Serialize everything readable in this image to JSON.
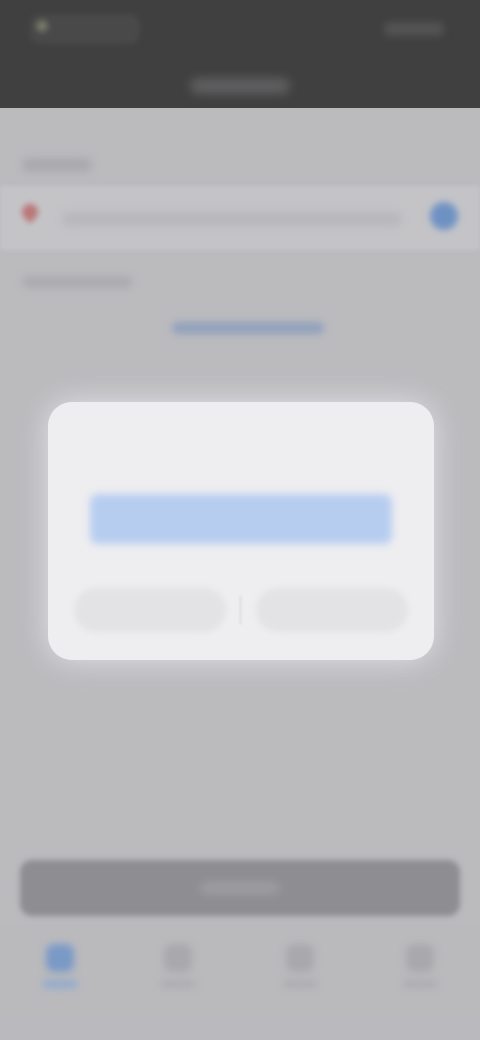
{
  "status_bar": {
    "left_text": "",
    "right_text": ""
  },
  "header": {
    "title": ""
  },
  "location": {
    "section_label": "",
    "address": "",
    "sub_label": "",
    "link": ""
  },
  "dialog": {
    "message": "",
    "link": "",
    "cancel_label": "",
    "confirm_label": ""
  },
  "footer": {
    "primary_button_label": ""
  },
  "tab_bar": {
    "tabs": [
      {
        "label": "",
        "icon": "home-icon",
        "active": true
      },
      {
        "label": "",
        "icon": "tab-icon",
        "active": false
      },
      {
        "label": "",
        "icon": "tab-icon",
        "active": false
      },
      {
        "label": "",
        "icon": "profile-icon",
        "active": false
      }
    ]
  },
  "colors": {
    "accent": "#5f8fd3",
    "dialog_bg": "#eeeef0",
    "overlay": "#bdbdc0",
    "status_bar": "#1f1f1f"
  }
}
